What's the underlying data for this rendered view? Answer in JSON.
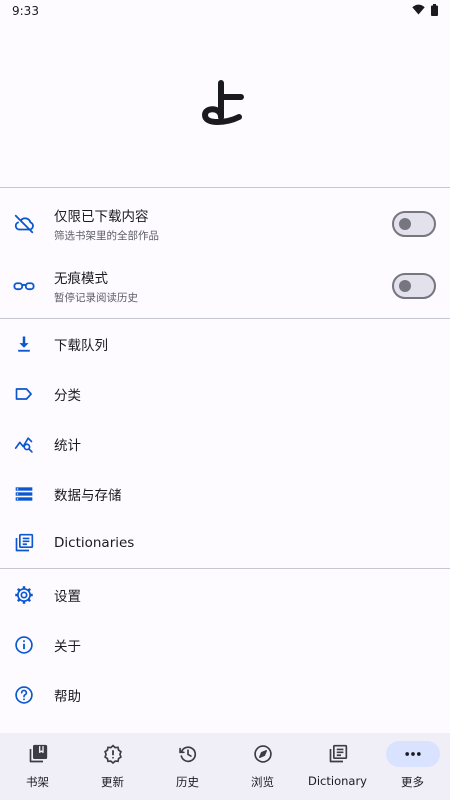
{
  "status": {
    "time": "9:33"
  },
  "logo": {
    "glyph": "よ"
  },
  "toggles": [
    {
      "title": "仅限已下载内容",
      "subtitle": "筛选书架里的全部作品",
      "icon": "cloud-off-icon",
      "on": false
    },
    {
      "title": "无痕模式",
      "subtitle": "暂停记录阅读历史",
      "icon": "glasses-icon",
      "on": false
    }
  ],
  "menu": [
    {
      "label": "下载队列",
      "icon": "download-icon"
    },
    {
      "label": "分类",
      "icon": "label-icon"
    },
    {
      "label": "统计",
      "icon": "stats-icon"
    },
    {
      "label": "数据与存储",
      "icon": "storage-icon"
    },
    {
      "label": "Dictionaries",
      "icon": "dictionary-icon"
    },
    {
      "label": "设置",
      "icon": "gear-icon"
    },
    {
      "label": "关于",
      "icon": "info-icon"
    },
    {
      "label": "帮助",
      "icon": "help-icon"
    }
  ],
  "nav": [
    {
      "label": "书架",
      "icon": "library-icon",
      "active": false
    },
    {
      "label": "更新",
      "icon": "updates-icon",
      "active": false
    },
    {
      "label": "历史",
      "icon": "history-icon",
      "active": false
    },
    {
      "label": "浏览",
      "icon": "compass-icon",
      "active": false
    },
    {
      "label": "Dictionary",
      "icon": "dictionary-icon",
      "active": false
    },
    {
      "label": "更多",
      "icon": "more-icon",
      "active": true
    }
  ],
  "colors": {
    "accent": "#0b57d0",
    "background": "#fdfbff",
    "nav_background": "#f0eef7",
    "nav_active_pill": "#d9e2ff"
  }
}
